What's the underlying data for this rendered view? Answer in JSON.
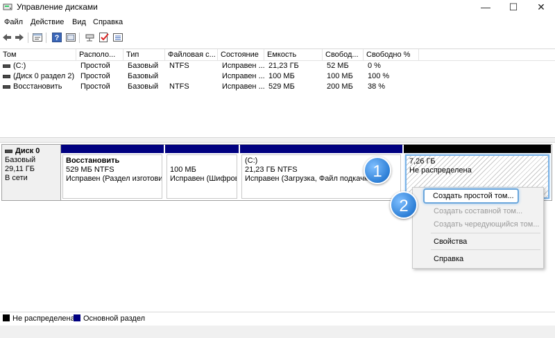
{
  "window": {
    "title": "Управление дисками",
    "minimize_glyph": "—",
    "maximize_glyph": "☐",
    "close_glyph": "✕"
  },
  "menu": [
    "Файл",
    "Действие",
    "Вид",
    "Справка"
  ],
  "toolbar": [
    "back-icon",
    "forward-icon",
    "properties-icon",
    "help-icon",
    "refresh-icon",
    "rescan-icon",
    "check-icon",
    "settings-icon"
  ],
  "volumes": {
    "columns": [
      "Том",
      "Располо...",
      "Тип",
      "Файловая с...",
      "Состояние",
      "Емкость",
      "Свобод...",
      "Свободно %"
    ],
    "rows": [
      [
        "(C:)",
        "Простой",
        "Базовый",
        "NTFS",
        "Исправен ...",
        "21,23 ГБ",
        "52 МБ",
        "0 %"
      ],
      [
        "(Диск 0 раздел 2)",
        "Простой",
        "Базовый",
        "",
        "Исправен ...",
        "100 МБ",
        "100 МБ",
        "100 %"
      ],
      [
        "Восстановить",
        "Простой",
        "Базовый",
        "NTFS",
        "Исправен ...",
        "529 МБ",
        "200 МБ",
        "38 %"
      ]
    ]
  },
  "disk": {
    "name": "Диск 0",
    "type": "Базовый",
    "size": "29,11 ГБ",
    "status": "В сети",
    "partitions": [
      {
        "line1": "Восстановить",
        "line2": "529 МБ NTFS",
        "line3": "Исправен (Раздел изготови"
      },
      {
        "line1": "",
        "line2": "100 МБ",
        "line3": "Исправен (Шифров"
      },
      {
        "line1": "(C:)",
        "line2": "21,23 ГБ NTFS",
        "line3": "Исправен (Загрузка, Файл подкачки, А..."
      },
      {
        "line1": "7,26 ГБ",
        "line2": "Не распределена"
      }
    ]
  },
  "context_menu": {
    "items": [
      {
        "label": "Создать простой том...",
        "enabled": true
      },
      {
        "label": "Создать составной том...",
        "enabled": false
      },
      {
        "label": "Создать чередующийся том...",
        "enabled": false
      },
      {
        "label": "Свойства",
        "enabled": true
      },
      {
        "label": "Справка",
        "enabled": true
      }
    ]
  },
  "badges": [
    "1",
    "2"
  ],
  "legend": [
    {
      "label": "Не распределена",
      "color": "#000000"
    },
    {
      "label": "Основной раздел",
      "color": "#000080"
    }
  ],
  "colors": {
    "primary_partition": "#000080",
    "unallocated": "#000000",
    "highlight": "#6aa6dc",
    "badge": "#2d7fd6"
  }
}
